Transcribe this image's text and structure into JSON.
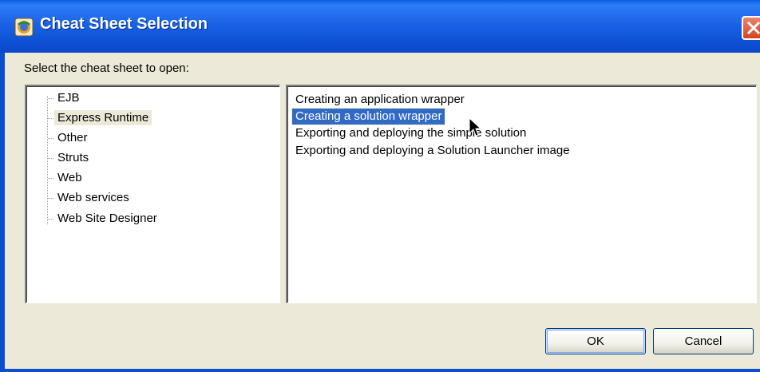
{
  "window": {
    "title": "Cheat Sheet Selection"
  },
  "instruction": "Select the cheat sheet to open:",
  "categories": [
    {
      "label": "EJB",
      "selected": false
    },
    {
      "label": "Express Runtime",
      "selected": true
    },
    {
      "label": "Other",
      "selected": false
    },
    {
      "label": "Struts",
      "selected": false
    },
    {
      "label": "Web",
      "selected": false
    },
    {
      "label": "Web services",
      "selected": false
    },
    {
      "label": "Web Site Designer",
      "selected": false
    }
  ],
  "cheat_sheets": [
    {
      "label": "Creating an application wrapper",
      "selected": false
    },
    {
      "label": "Creating a solution wrapper",
      "selected": true
    },
    {
      "label": "Exporting and deploying the simple solution",
      "selected": false
    },
    {
      "label": "Exporting and deploying a Solution Launcher image",
      "selected": false
    }
  ],
  "buttons": {
    "ok": "OK",
    "cancel": "Cancel"
  },
  "colors": {
    "titlebar": "#0b4fd0",
    "selection": "#316ac5",
    "dialog_bg": "#ece9d8"
  },
  "icons": {
    "title": "eclipse-app-icon",
    "close": "close-x-icon"
  }
}
